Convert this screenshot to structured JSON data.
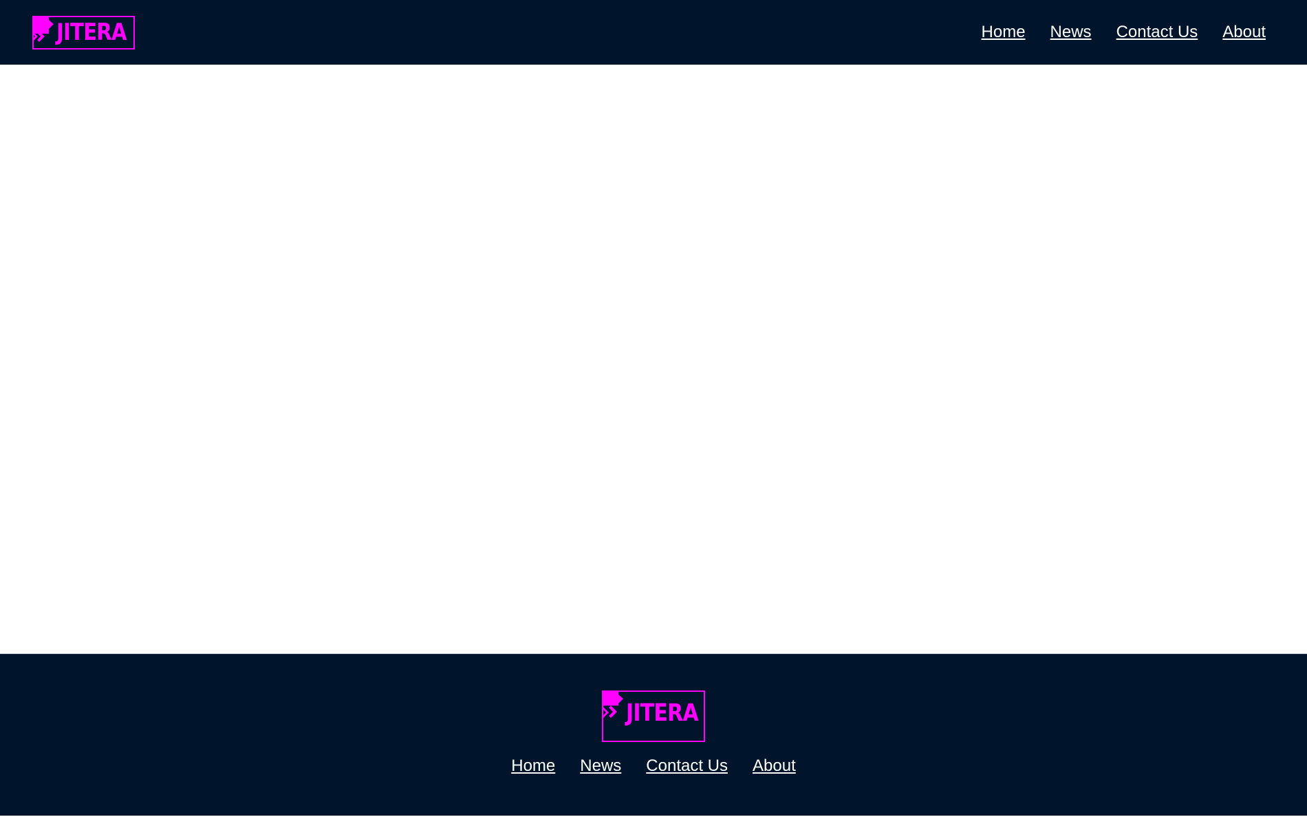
{
  "brand": {
    "name": "JITERA",
    "color": "#ff00ff"
  },
  "header": {
    "background": "#00152b",
    "nav": [
      {
        "label": "Home"
      },
      {
        "label": "News"
      },
      {
        "label": "Contact Us"
      },
      {
        "label": "About"
      }
    ]
  },
  "footer": {
    "background": "#00152b",
    "nav": [
      {
        "label": "Home"
      },
      {
        "label": "News"
      },
      {
        "label": "Contact Us"
      },
      {
        "label": "About"
      }
    ]
  },
  "icons": {
    "logo_mark": "jitera-logo-icon"
  }
}
